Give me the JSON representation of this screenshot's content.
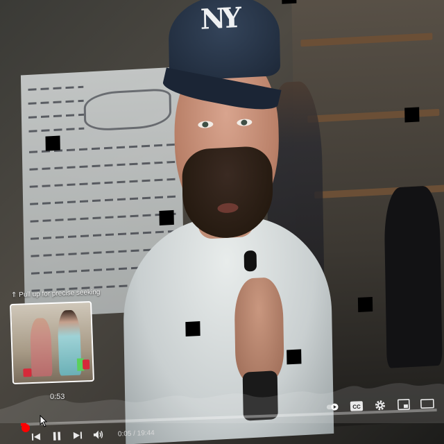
{
  "player": {
    "seek_hint": "⇑ Pull up for precise seeking",
    "preview_time": "0:53",
    "time_current": "0:05",
    "time_total": "19:44",
    "time_display": "0:05 / 19:44",
    "cap_logo": "NY",
    "progress_fraction": 0.004,
    "accent_color": "#ff0000"
  },
  "controls": {
    "left": [
      "previous-icon",
      "pause-icon",
      "next-icon",
      "volume-icon"
    ],
    "right": [
      "autoplay-toggle-icon",
      "captions-icon",
      "settings-gear-icon",
      "miniplayer-icon",
      "theater-mode-icon"
    ],
    "captions_label": "CC"
  }
}
